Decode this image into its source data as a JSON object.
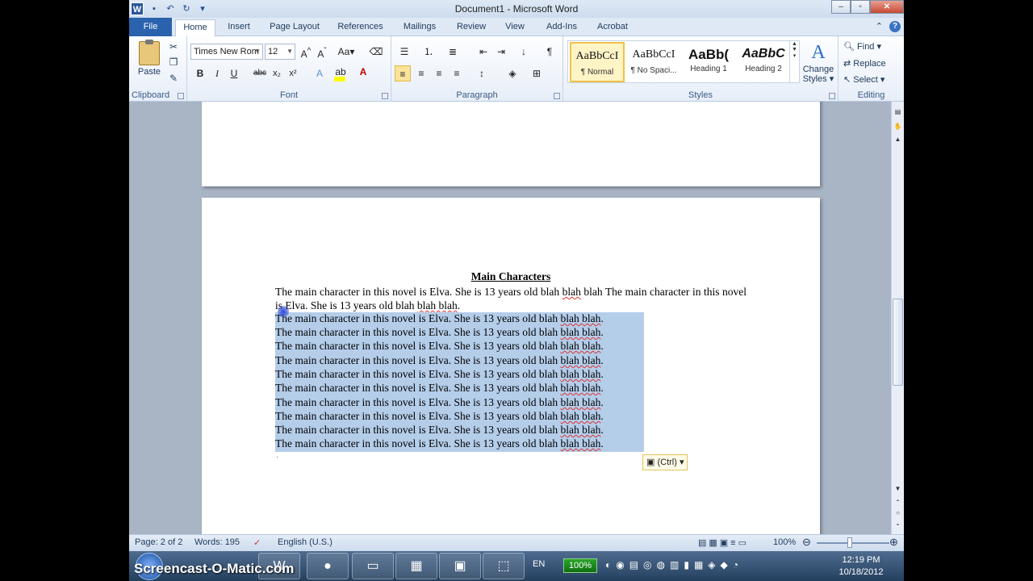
{
  "window": {
    "title": "Document1  -  Microsoft Word"
  },
  "tabs": [
    "File",
    "Home",
    "Insert",
    "Page Layout",
    "References",
    "Mailings",
    "Review",
    "View",
    "Add-Ins",
    "Acrobat"
  ],
  "ribbon": {
    "clipboard": {
      "paste_label": "Paste",
      "group_label": "Clipboard"
    },
    "font": {
      "font_name": "Times New Rom",
      "font_size": "12",
      "group_label": "Font"
    },
    "paragraph": {
      "group_label": "Paragraph"
    },
    "styles": {
      "items": [
        {
          "sample": "AaBbCcI",
          "name": "¶ Normal"
        },
        {
          "sample": "AaBbCcI",
          "name": "¶ No Spaci..."
        },
        {
          "sample": "AaBb(",
          "name": "Heading 1"
        },
        {
          "sample": "AaBbC",
          "name": "Heading 2"
        }
      ],
      "change_styles_label_1": "Change",
      "change_styles_label_2": "Styles",
      "group_label": "Styles"
    },
    "editing": {
      "find": "Find",
      "replace": "Replace",
      "select": "Select",
      "group_label": "Editing"
    }
  },
  "document": {
    "heading": "Main Characters",
    "intro_a": "The main character in this novel is Elva. She is 13 years old blah ",
    "intro_b": "blah",
    "intro_c": " blah The main character in this novel is Elva. She is 13 years old blah ",
    "intro_d": "blah blah",
    "intro_e": ".",
    "selected_line_a": "The main character in this novel is Elva. She is 13 years old blah ",
    "selected_line_b": "blah blah",
    "selected_line_c": ".",
    "paste_options": "(Ctrl)"
  },
  "statusbar": {
    "page": "Page: 2 of 2",
    "words": "Words: 195",
    "language": "English (U.S.)",
    "zoom": "100%"
  },
  "taskbar": {
    "watermark": "Screencast-O-Matic.com",
    "language": "EN",
    "battery": "100%",
    "time": "12:19 PM",
    "date": "10/18/2012"
  },
  "colors": {
    "accent": "#2a62ad",
    "selection": "#b4cde9",
    "doc_background": "#a9b5c5"
  }
}
